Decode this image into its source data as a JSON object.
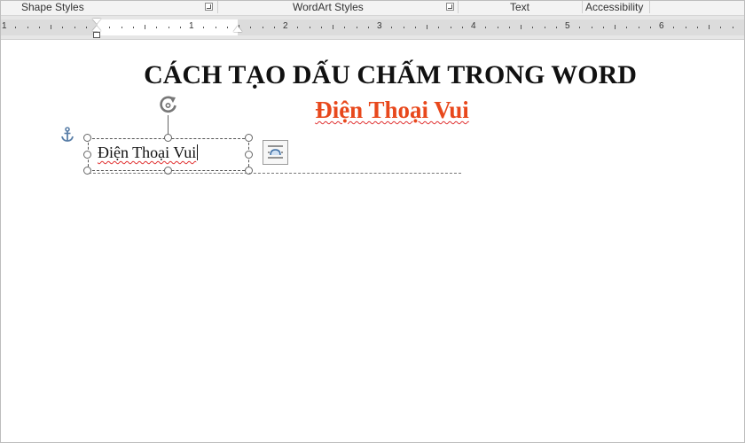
{
  "ribbon": {
    "groups": [
      {
        "label": "Shape Styles"
      },
      {
        "label": "WordArt Styles"
      },
      {
        "label": "Text"
      },
      {
        "label": "Accessibility"
      }
    ]
  },
  "ruler": {
    "numbers": [
      "1",
      "1",
      "2",
      "3",
      "4",
      "5",
      "6"
    ]
  },
  "document": {
    "title": "CÁCH TẠO DẤU CHẤM TRONG WORD",
    "subtitle": "Điện Thoại Vui",
    "textbox_text": "Điện Thoại Vui"
  },
  "colors": {
    "subtitle": "#e8481c",
    "spellcheck_underline": "#e03030",
    "anchor": "#5a7fa8"
  },
  "icons": {
    "anchor": "anchor-icon",
    "rotate": "rotate-icon",
    "layout_options": "layout-options-icon",
    "dialog_launcher": "dialog-launcher-icon"
  }
}
